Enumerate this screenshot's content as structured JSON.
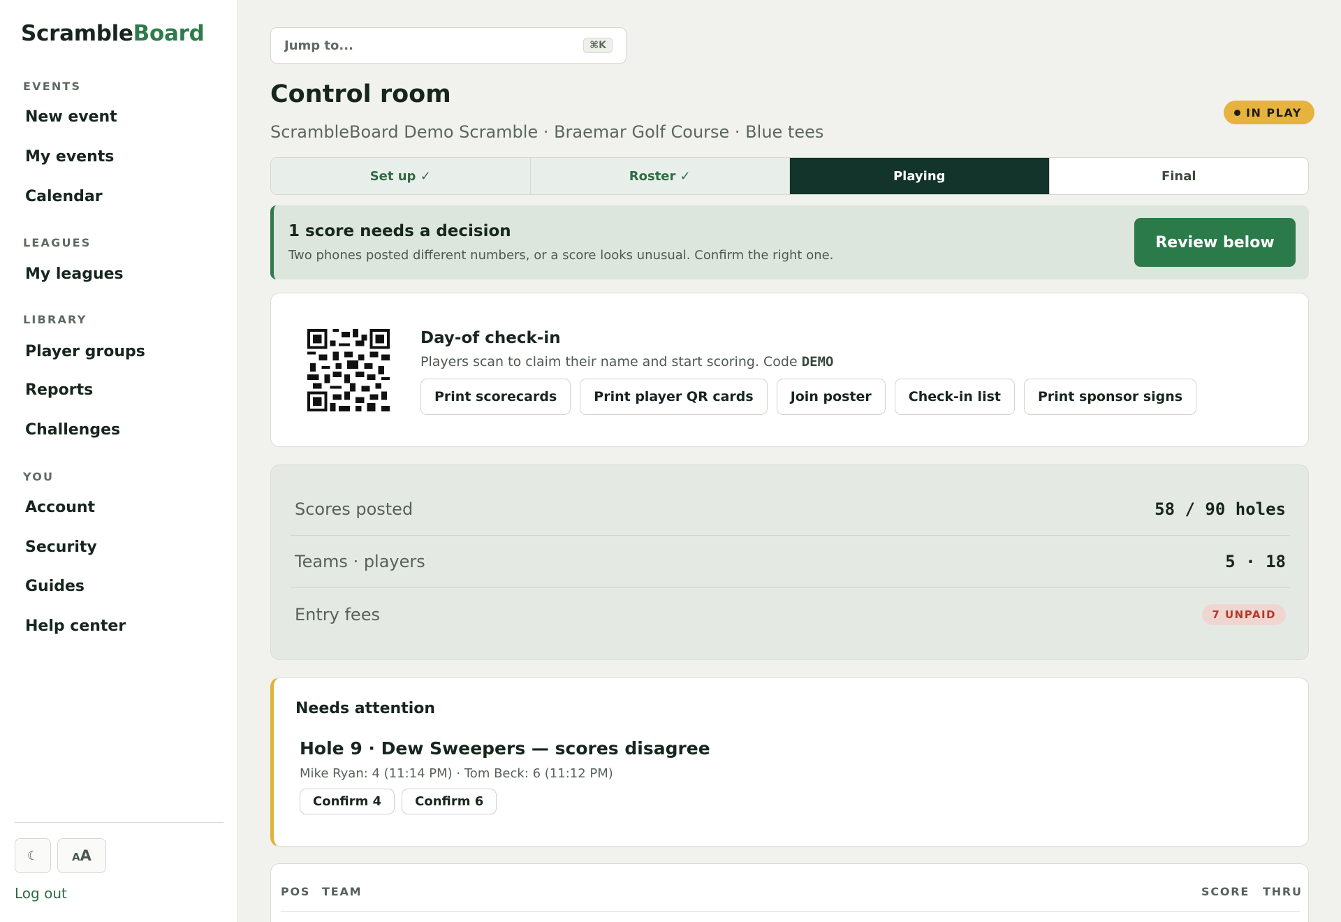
{
  "brand": {
    "part1": "Scramble",
    "part2": "Board"
  },
  "sidebar": {
    "groups": [
      {
        "label": "EVENTS",
        "items": [
          "New event",
          "My events",
          "Calendar"
        ]
      },
      {
        "label": "LEAGUES",
        "items": [
          "My leagues"
        ]
      },
      {
        "label": "LIBRARY",
        "items": [
          "Player groups",
          "Reports",
          "Challenges"
        ]
      },
      {
        "label": "YOU",
        "items": [
          "Account",
          "Security",
          "Guides",
          "Help center"
        ]
      }
    ],
    "theme_toggle_icon": "moon-icon",
    "text_size_small": "A",
    "text_size_large": "A",
    "logout": "Log out"
  },
  "search": {
    "placeholder": "Jump to...",
    "shortcut": "⌘K"
  },
  "header": {
    "title": "Control room",
    "subtitle": "ScrambleBoard Demo Scramble · Braemar Golf Course · Blue tees",
    "status": "IN PLAY",
    "status_color": "#e7b33f"
  },
  "steps": [
    {
      "label": "Set up ✓",
      "state": "done"
    },
    {
      "label": "Roster ✓",
      "state": "done"
    },
    {
      "label": "Playing",
      "state": "active"
    },
    {
      "label": "Final",
      "state": "todo"
    }
  ],
  "alert": {
    "title": "1 score needs a decision",
    "text": "Two phones posted different numbers, or a score looks unusual. Confirm the right one.",
    "button": "Review below"
  },
  "checkin": {
    "title": "Day-of check-in",
    "text": "Players scan to claim their name and start scoring. Code ",
    "code": "DEMO",
    "actions": [
      "Print scorecards",
      "Print player QR cards",
      "Join poster",
      "Check-in list",
      "Print sponsor signs"
    ]
  },
  "stats": {
    "scores_label": "Scores posted",
    "scores_value": "58 / 90 holes",
    "teams_label": "Teams · players",
    "teams_value": "5 · 18",
    "fees_label": "Entry fees",
    "fees_value": "7 UNPAID"
  },
  "attention": {
    "title": "Needs attention",
    "item_title": "Hole 9 · Dew Sweepers — scores disagree",
    "item_meta": "Mike Ryan: 4 (11:14 PM) · Tom Beck: 6 (11:12 PM)",
    "confirm_a": "Confirm 4",
    "confirm_b": "Confirm 6"
  },
  "leaderboard": {
    "columns": [
      "POS",
      "TEAM",
      "SCORE",
      "THRU"
    ]
  },
  "colors": {
    "accent": "#2f7b4d",
    "dark": "#12342a",
    "warning": "#e1b23b",
    "danger": "#b4392b"
  }
}
